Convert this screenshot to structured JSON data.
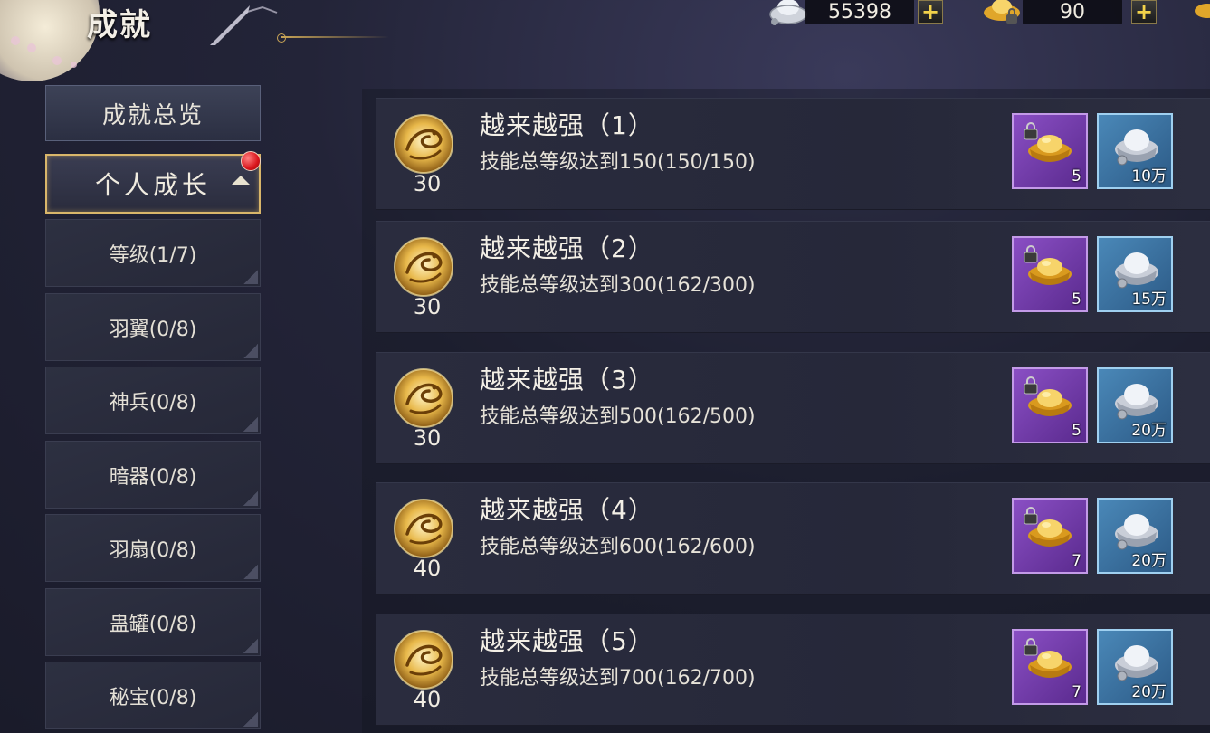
{
  "header": {
    "title": "成就",
    "silver_amount": "55398",
    "gold_amount": "90",
    "plus_label": "+"
  },
  "sidebar": {
    "overview_label": "成就总览",
    "category_label": "个人成长",
    "items": [
      {
        "label": "等级(1/7)"
      },
      {
        "label": "羽翼(0/8)"
      },
      {
        "label": "神兵(0/8)"
      },
      {
        "label": "暗器(0/8)"
      },
      {
        "label": "羽扇(0/8)"
      },
      {
        "label": "蛊罐(0/8)"
      },
      {
        "label": "秘宝(0/8)"
      }
    ]
  },
  "achievements": [
    {
      "title": "越来越强（1）",
      "desc": "技能总等级达到150(150/150)",
      "points": "30",
      "gold_reward": "5",
      "silver_reward": "10万"
    },
    {
      "title": "越来越强（2）",
      "desc": "技能总等级达到300(162/300)",
      "points": "30",
      "gold_reward": "5",
      "silver_reward": "15万"
    },
    {
      "title": "越来越强（3）",
      "desc": "技能总等级达到500(162/500)",
      "points": "30",
      "gold_reward": "5",
      "silver_reward": "20万"
    },
    {
      "title": "越来越强（4）",
      "desc": "技能总等级达到600(162/600)",
      "points": "40",
      "gold_reward": "7",
      "silver_reward": "20万"
    },
    {
      "title": "越来越强（5）",
      "desc": "技能总等级达到700(162/700)",
      "points": "40",
      "gold_reward": "7",
      "silver_reward": "20万"
    }
  ],
  "icons": {
    "medal": "dragon-medal-icon",
    "gold": "gold-ingot-icon",
    "silver": "silver-ingot-icon",
    "lock": "lock-icon"
  },
  "colors": {
    "accent_gold": "#d9b66a",
    "gold_reward_bg": "#7a44b4",
    "silver_reward_bg": "#3e78a8",
    "notification": "#d9141b"
  }
}
